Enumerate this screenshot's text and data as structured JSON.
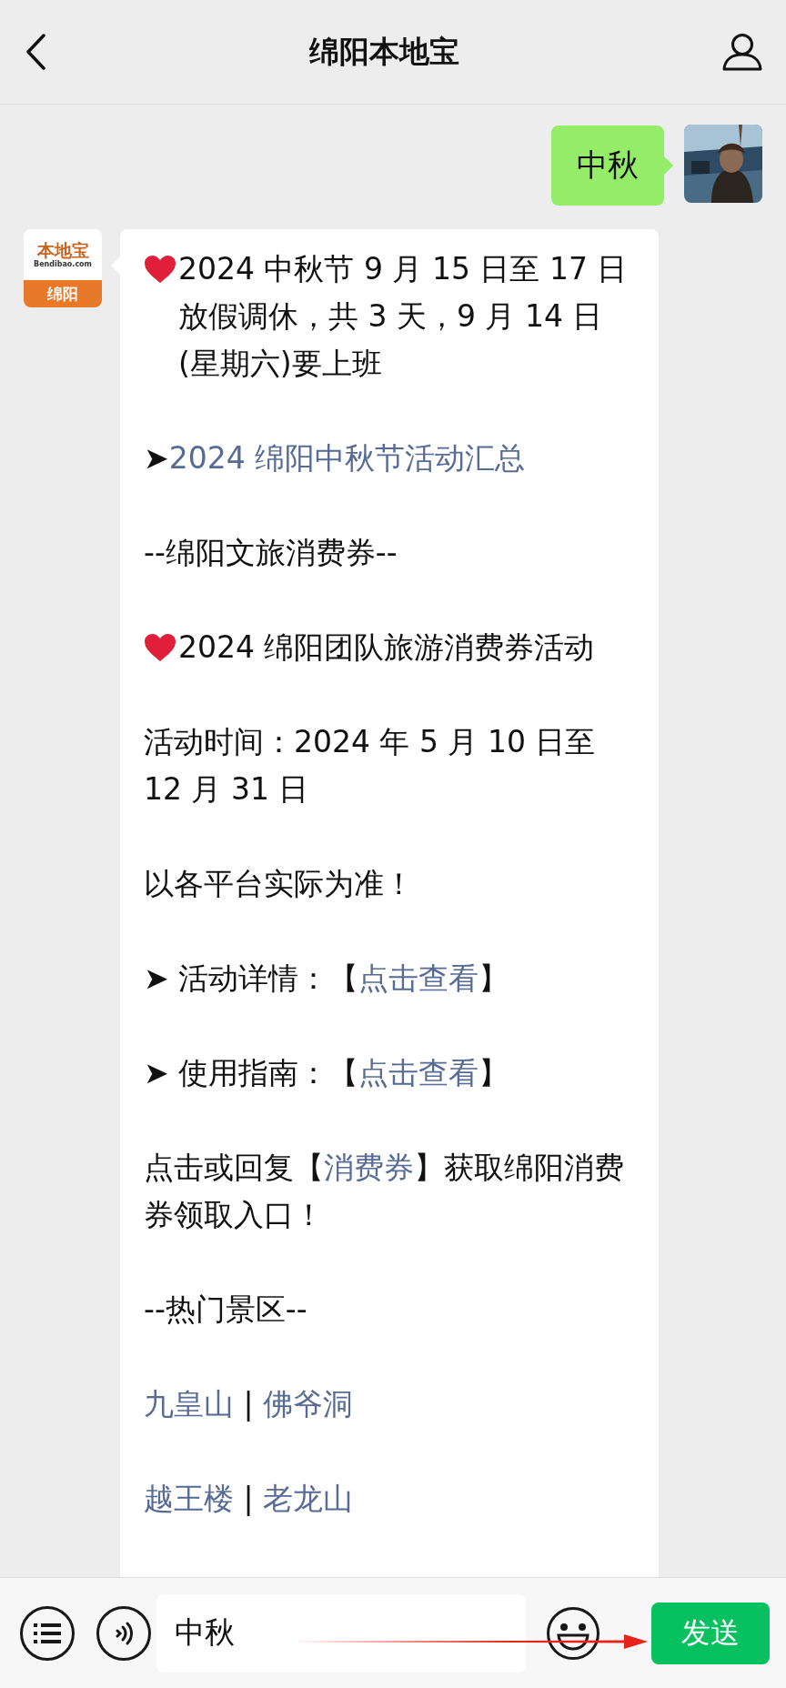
{
  "header": {
    "title": "绵阳本地宝"
  },
  "messages": [
    {
      "kind": "outgoing",
      "text": "中秋"
    },
    {
      "kind": "incoming",
      "logo": {
        "brand": "本地宝",
        "domain": "Bendibao.com",
        "city": "绵阳"
      },
      "paragraphs": [
        {
          "kind": "heart",
          "segments": [
            {
              "kind": "plain",
              "text": "2024 中秋节 9 月 15 日至 17 日放假调休，共 3 天，9 月 14 日(星期六)要上班"
            }
          ]
        },
        {
          "segments": [
            {
              "kind": "plain",
              "text": "➤"
            },
            {
              "kind": "link",
              "text": "2024 绵阳中秋节活动汇总"
            }
          ]
        },
        {
          "segments": [
            {
              "kind": "plain",
              "text": "--绵阳文旅消费券--"
            }
          ]
        },
        {
          "kind": "heart",
          "segments": [
            {
              "kind": "plain",
              "text": "2024 绵阳团队旅游消费券活动"
            }
          ]
        },
        {
          "segments": [
            {
              "kind": "plain",
              "text": "活动时间：2024 年 5 月 10 日至 12 月 31 日"
            }
          ]
        },
        {
          "segments": [
            {
              "kind": "plain",
              "text": "以各平台实际为准！"
            }
          ]
        },
        {
          "segments": [
            {
              "kind": "plain",
              "text": "➤ 活动详情：【"
            },
            {
              "kind": "link",
              "text": "点击查看"
            },
            {
              "kind": "plain",
              "text": "】"
            }
          ]
        },
        {
          "segments": [
            {
              "kind": "plain",
              "text": "➤ 使用指南：【"
            },
            {
              "kind": "link",
              "text": "点击查看"
            },
            {
              "kind": "plain",
              "text": "】"
            }
          ]
        },
        {
          "segments": [
            {
              "kind": "plain",
              "text": "点击或回复【"
            },
            {
              "kind": "link",
              "text": "消费券"
            },
            {
              "kind": "plain",
              "text": "】获取绵阳消费券领取入口！"
            }
          ]
        },
        {
          "segments": [
            {
              "kind": "plain",
              "text": "--热门景区--"
            }
          ]
        },
        {
          "segments": [
            {
              "kind": "link",
              "text": "九皇山"
            },
            {
              "kind": "plain",
              "text": " | "
            },
            {
              "kind": "link",
              "text": "佛爷洞"
            }
          ]
        },
        {
          "segments": [
            {
              "kind": "link",
              "text": "越王楼"
            },
            {
              "kind": "plain",
              "text": " | "
            },
            {
              "kind": "link",
              "text": "老龙山"
            }
          ]
        }
      ]
    }
  ],
  "input_bar": {
    "value": "中秋",
    "send_label": "发送"
  }
}
